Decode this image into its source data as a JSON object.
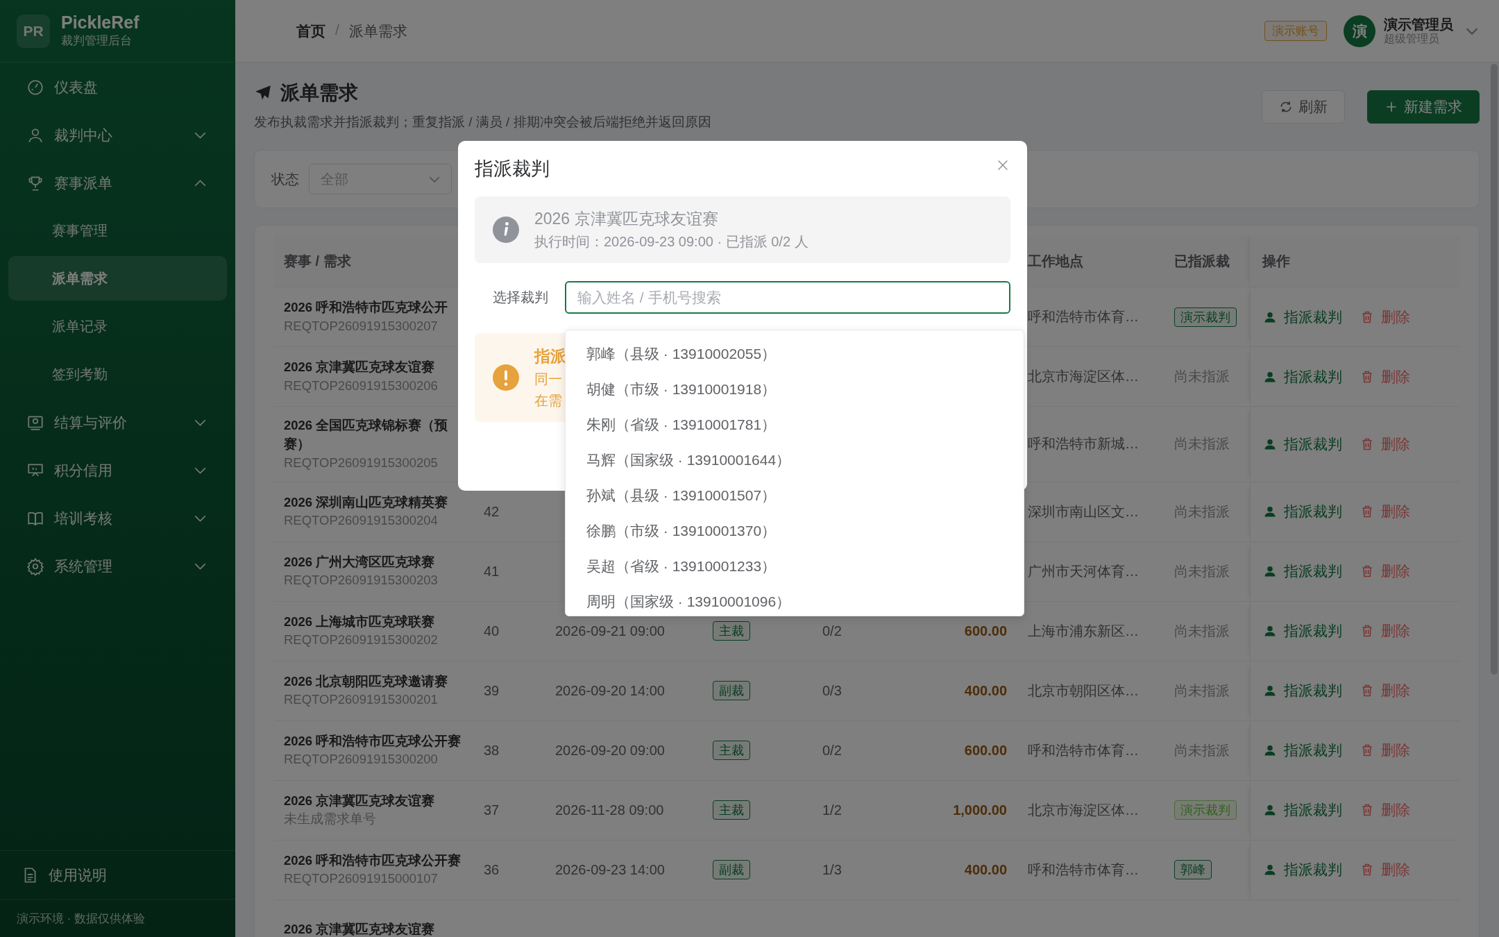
{
  "sidebar": {
    "logo": "PR",
    "brand": "PickleRef",
    "subtitle": "裁判管理后台",
    "items": [
      {
        "label": "仪表盘"
      },
      {
        "label": "裁判中心",
        "expanded": false
      },
      {
        "label": "赛事派单",
        "expanded": true,
        "children": [
          {
            "label": "赛事管理",
            "selected": false
          },
          {
            "label": "派单需求",
            "selected": true
          },
          {
            "label": "派单记录",
            "selected": false
          },
          {
            "label": "签到考勤",
            "selected": false
          }
        ]
      },
      {
        "label": "结算与评价",
        "expanded": false
      },
      {
        "label": "积分信用",
        "expanded": false
      },
      {
        "label": "培训考核",
        "expanded": false
      },
      {
        "label": "系统管理",
        "expanded": false
      }
    ],
    "help": "使用说明",
    "footer": "演示环境 · 数据仅供体验"
  },
  "header": {
    "breadcrumb": [
      "首页",
      "/",
      "派单需求"
    ],
    "badge": "演示账号",
    "avatar": "演",
    "user_name": "演示管理员",
    "user_role": "超级管理员"
  },
  "page": {
    "title": "派单需求",
    "subtitle": "发布执裁需求并指派裁判；重复指派 / 满员 / 排期冲突会被后端拒绝并返回原因",
    "buttons": [
      {
        "label": "刷新",
        "kind": "refresh"
      },
      {
        "label": "新建需求",
        "kind": "primary"
      }
    ]
  },
  "filter": {
    "label": "状态",
    "value": "全部"
  },
  "table": {
    "columns": [
      "赛事 / 需求",
      "",
      "",
      "",
      "",
      "",
      "工作地点",
      "已指派裁",
      "操作"
    ],
    "rows": [
      {
        "name": "2026 呼和浩特市匹克球公开",
        "code": "REQTOP26091915300207",
        "location": "呼和浩特市体育…",
        "assigned": {
          "text": "演示裁判",
          "kind": "tag"
        },
        "actions": [
          {
            "label": "指派裁判",
            "kind": "assign"
          },
          {
            "label": "删除",
            "kind": "delete"
          }
        ]
      },
      {
        "name": "2026 京津冀匹克球友谊赛",
        "code": "REQTOP26091915300206",
        "location": "北京市海淀区体…",
        "assigned": {
          "text": "尚未指派",
          "kind": "empty"
        },
        "actions": [
          {
            "label": "指派裁判",
            "kind": "assign"
          },
          {
            "label": "删除",
            "kind": "delete"
          }
        ]
      },
      {
        "name": "2026 全国匹克球锦标赛（预赛）",
        "code": "REQTOP26091915300205",
        "location": "呼和浩特市新城…",
        "assigned": {
          "text": "尚未指派",
          "kind": "empty"
        },
        "actions": [
          {
            "label": "指派裁判",
            "kind": "assign"
          },
          {
            "label": "删除",
            "kind": "delete"
          }
        ]
      },
      {
        "name": "2026 深圳南山匹克球精英赛",
        "code": "REQTOP26091915300204",
        "num": "42",
        "location": "深圳市南山区文…",
        "assigned": {
          "text": "尚未指派",
          "kind": "empty"
        },
        "actions": [
          {
            "label": "指派裁判",
            "kind": "assign"
          },
          {
            "label": "删除",
            "kind": "delete"
          }
        ]
      },
      {
        "name": "2026 广州大湾区匹克球赛",
        "code": "REQTOP26091915300203",
        "num": "41",
        "location": "广州市天河体育…",
        "assigned": {
          "text": "尚未指派",
          "kind": "empty"
        },
        "actions": [
          {
            "label": "指派裁判",
            "kind": "assign"
          },
          {
            "label": "删除",
            "kind": "delete"
          }
        ]
      },
      {
        "name": "2026 上海城市匹克球联赛",
        "code": "REQTOP26091915300202",
        "num": "40",
        "time": "2026-09-21 09:00",
        "role": "主裁",
        "count": "0/2",
        "amount": "600.00",
        "location": "上海市浦东新区…",
        "assigned": {
          "text": "尚未指派",
          "kind": "empty"
        },
        "actions": [
          {
            "label": "指派裁判",
            "kind": "assign"
          },
          {
            "label": "删除",
            "kind": "delete"
          }
        ]
      },
      {
        "name": "2026 北京朝阳匹克球邀请赛",
        "code": "REQTOP26091915300201",
        "num": "39",
        "time": "2026-09-20 14:00",
        "role": "副裁",
        "count": "0/3",
        "amount": "400.00",
        "location": "北京市朝阳区体…",
        "assigned": {
          "text": "尚未指派",
          "kind": "empty"
        },
        "actions": [
          {
            "label": "指派裁判",
            "kind": "assign"
          },
          {
            "label": "删除",
            "kind": "delete"
          }
        ]
      },
      {
        "name": "2026 呼和浩特市匹克球公开赛",
        "code": "REQTOP26091915300200",
        "num": "38",
        "time": "2026-09-20 09:00",
        "role": "主裁",
        "count": "0/2",
        "amount": "600.00",
        "location": "呼和浩特市体育…",
        "assigned": {
          "text": "尚未指派",
          "kind": "empty"
        },
        "actions": [
          {
            "label": "指派裁判",
            "kind": "assign"
          },
          {
            "label": "删除",
            "kind": "delete"
          }
        ]
      },
      {
        "name": "2026 京津冀匹克球友谊赛",
        "code": "未生成需求单号",
        "num": "37",
        "time": "2026-11-28 09:00",
        "role": "主裁",
        "count": "1/2",
        "amount": "1,000.00",
        "location": "北京市海淀区体…",
        "assigned": {
          "text": "演示裁判",
          "kind": "tag-light"
        },
        "actions": [
          {
            "label": "指派裁判",
            "kind": "assign"
          },
          {
            "label": "删除",
            "kind": "delete"
          }
        ]
      },
      {
        "name": "2026 呼和浩特市匹克球公开赛",
        "code": "REQTOP26091915000107",
        "num": "36",
        "time": "2026-09-23 14:00",
        "role": "副裁",
        "count": "1/3",
        "amount": "400.00",
        "location": "呼和浩特市体育…",
        "assigned": {
          "text": "郭峰",
          "kind": "tag"
        },
        "actions": [
          {
            "label": "指派裁判",
            "kind": "assign"
          },
          {
            "label": "删除",
            "kind": "delete"
          }
        ]
      },
      {
        "name": "2026 京津冀匹克球友谊赛"
      }
    ]
  },
  "dialog": {
    "title": "指派裁判",
    "info_title": "2026 京津冀匹克球友谊赛",
    "info_text": "执行时间：2026-09-23 09:00 · 已指派 0/2 人",
    "field_label": "选择裁判",
    "placeholder": "输入姓名 / 手机号搜索",
    "warning_title": "指派",
    "warning_lines": [
      "同一",
      "在需"
    ],
    "options": [
      "郭峰（县级 · 13910002055）",
      "胡健（市级 · 13910001918）",
      "朱刚（省级 · 13910001781）",
      "马辉（国家级 · 13910001644）",
      "孙斌（县级 · 13910001507）",
      "徐鹏（市级 · 13910001370）",
      "吴超（省级 · 13910001233）",
      "周明（国家级 · 13910001096）"
    ]
  }
}
